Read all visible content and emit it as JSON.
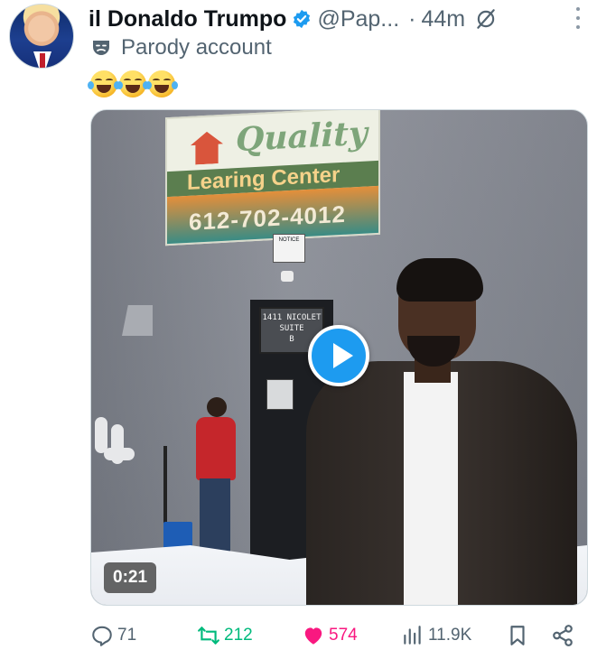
{
  "post": {
    "author": {
      "display_name": "il Donaldo Trumpo",
      "handle": "@Pap...",
      "separator": "·",
      "time": "44m",
      "label": "Parody account"
    },
    "text": "😂😂😂",
    "media": {
      "duration": "0:21",
      "sign": {
        "title": "Quality",
        "subtitle": "Learing Center",
        "phone": "612-702-4012",
        "notice": "NOTICE"
      },
      "door_sign": [
        "1411 NICOLET",
        "SUITE",
        "B"
      ]
    },
    "actions": {
      "replies": "71",
      "reposts": "212",
      "likes": "574",
      "views": "11.9K"
    }
  },
  "colors": {
    "accent": "#1d9bf0",
    "repost": "#00ba7c",
    "like": "#f91880",
    "muted": "#536471"
  }
}
